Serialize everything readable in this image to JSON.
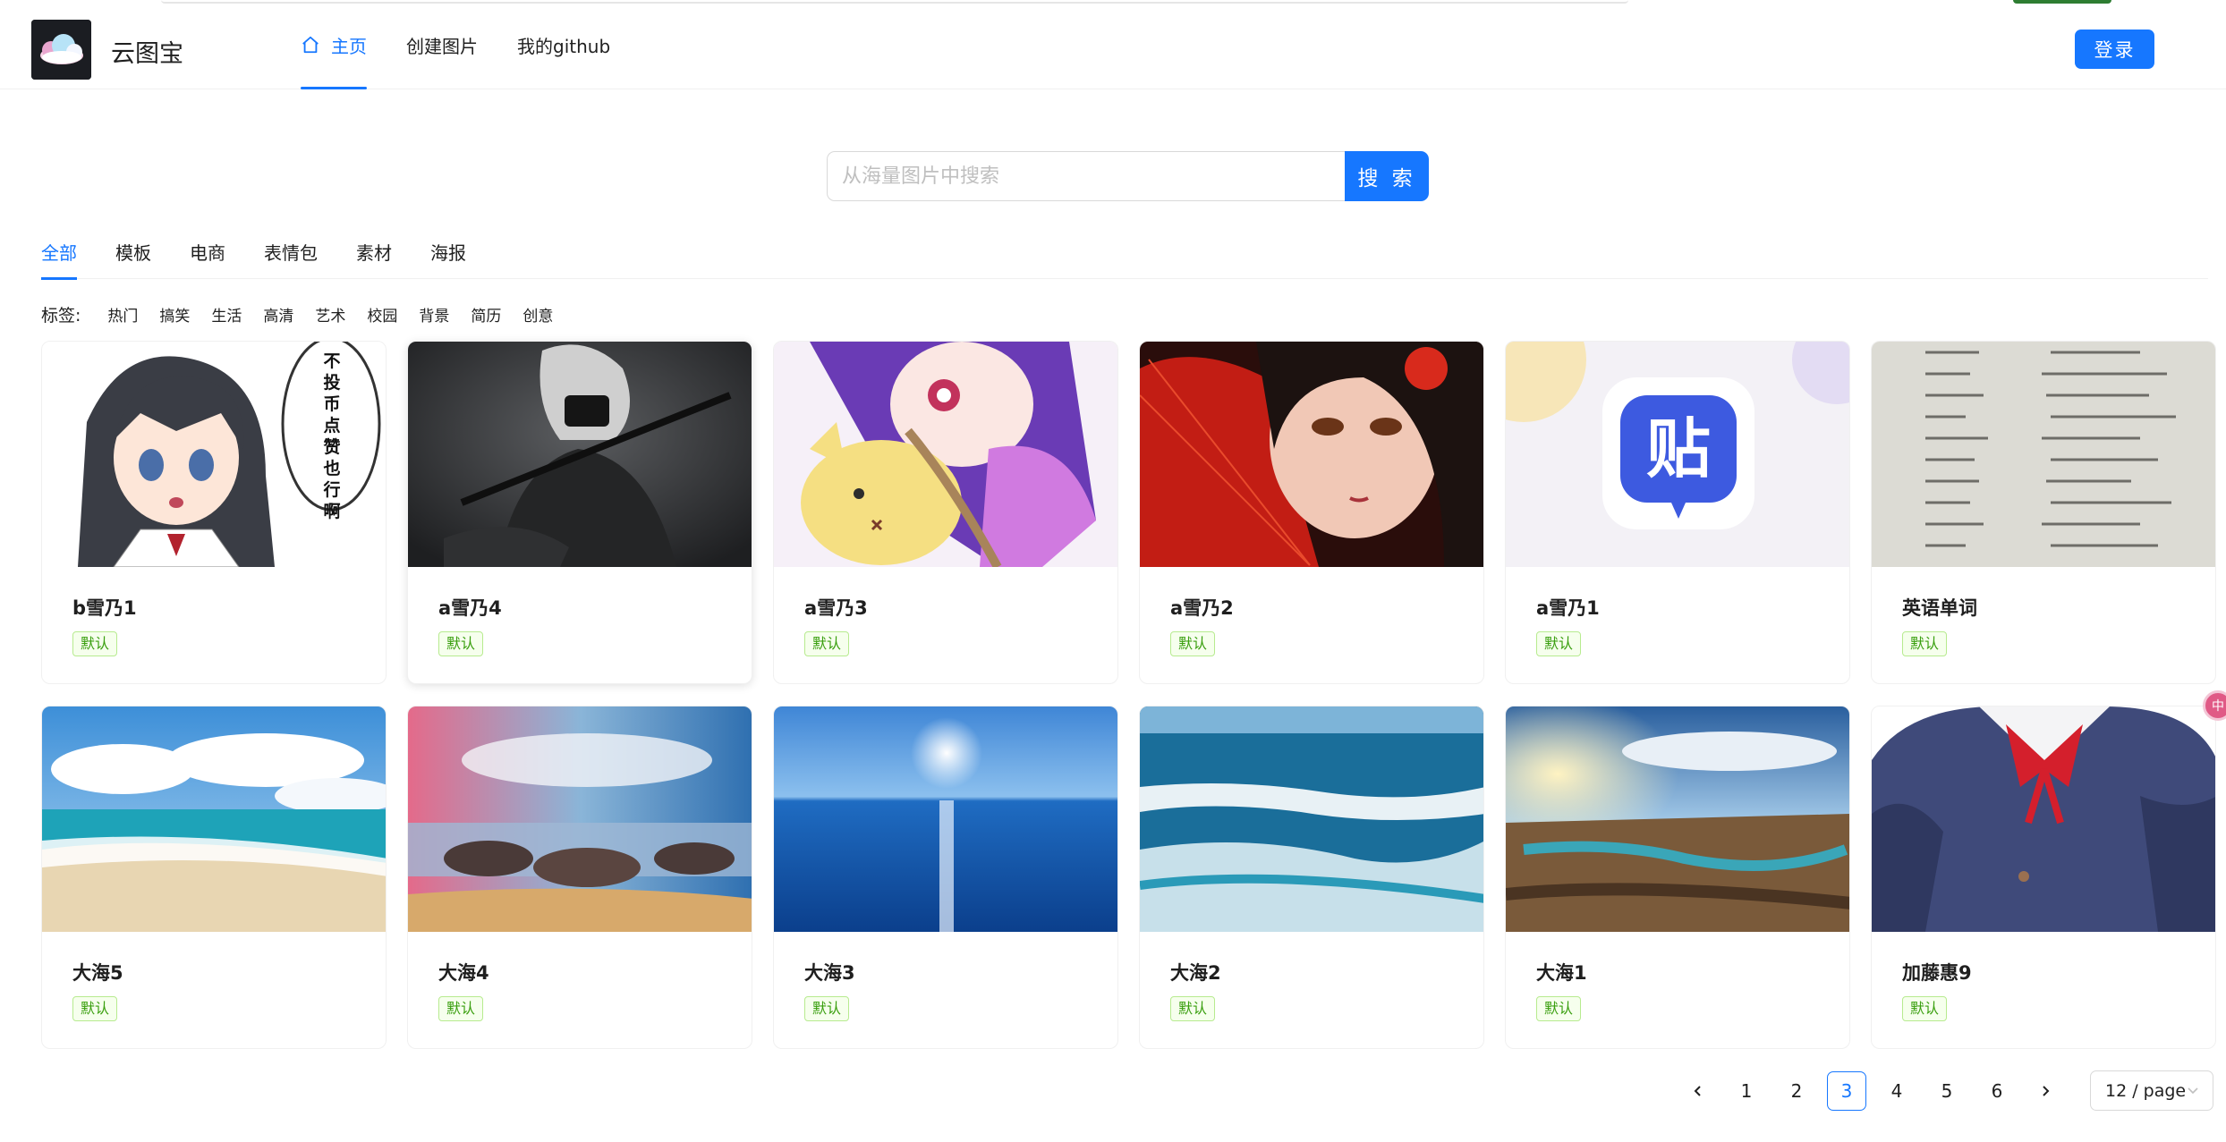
{
  "header": {
    "site_title": "云图宝",
    "nav": [
      {
        "label": "主页",
        "icon": "home-icon",
        "active": true
      },
      {
        "label": "创建图片",
        "active": false
      },
      {
        "label": "我的github",
        "active": false
      }
    ],
    "login_label": "登录"
  },
  "search": {
    "placeholder": "从海量图片中搜索",
    "value": "",
    "button_label": "搜 索"
  },
  "categories": {
    "items": [
      "全部",
      "模板",
      "电商",
      "表情包",
      "素材",
      "海报"
    ],
    "active": "全部"
  },
  "tags": {
    "label": "标签:",
    "items": [
      "热门",
      "搞笑",
      "生活",
      "高清",
      "艺术",
      "校园",
      "背景",
      "简历",
      "创意"
    ]
  },
  "pictures": [
    {
      "name": "b雪乃1",
      "tag": "默认",
      "thumb": "anime-girl-speech-bubble"
    },
    {
      "name": "a雪乃4",
      "tag": "默认",
      "thumb": "dark-masked-warrior"
    },
    {
      "name": "a雪乃3",
      "tag": "默认",
      "thumb": "purple-hair-anime-with-yellow-cat"
    },
    {
      "name": "a雪乃2",
      "tag": "默认",
      "thumb": "girl-with-red-fan"
    },
    {
      "name": "a雪乃1",
      "tag": "默认",
      "thumb": "tieba-app-logo"
    },
    {
      "name": "英语单词",
      "tag": "默认",
      "thumb": "english-vocabulary-page"
    },
    {
      "name": "大海5",
      "tag": "默认",
      "thumb": "beach-with-clouds"
    },
    {
      "name": "大海4",
      "tag": "默认",
      "thumb": "rocky-shore-sunset"
    },
    {
      "name": "大海3",
      "tag": "默认",
      "thumb": "open-sea-sun-reflection"
    },
    {
      "name": "大海2",
      "tag": "默认",
      "thumb": "ocean-waves"
    },
    {
      "name": "大海1",
      "tag": "默认",
      "thumb": "rocky-coast-sunrise"
    },
    {
      "name": "加藤惠9",
      "tag": "默认",
      "thumb": "anime-school-uniform"
    }
  ],
  "overlay_texts": {
    "speech_bubble": "不投币点赞也行啊",
    "app_logo_char": "贴"
  },
  "pagination": {
    "pages": [
      "1",
      "2",
      "3",
      "4",
      "5",
      "6"
    ],
    "current": "3",
    "page_size_label": "12 / page"
  },
  "float_badge": "中",
  "colors": {
    "primary": "#1677ff",
    "tag_text": "#389e0d",
    "tag_bg": "#f6ffed",
    "tag_border": "#b7eb8f"
  }
}
